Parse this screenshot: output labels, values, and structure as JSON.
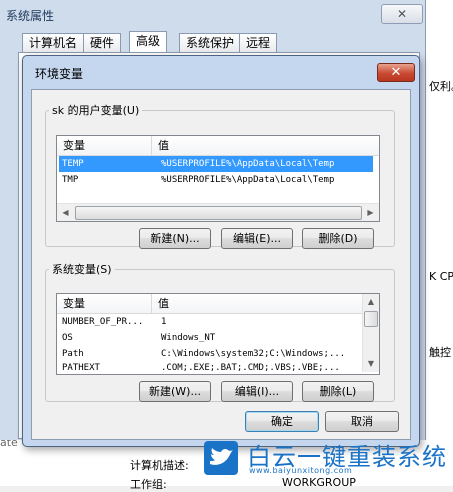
{
  "background": {
    "right_fragments": [
      "仅利。",
      "K CP",
      "触控",
      "ate"
    ],
    "bottom_fragments": [
      "计算机描述:",
      "工作组:",
      "WORKGROUP"
    ]
  },
  "system_properties": {
    "title": "系统属性",
    "close_label": "✕",
    "tabs": [
      {
        "label": "计算机名"
      },
      {
        "label": "硬件"
      },
      {
        "label": "高级"
      },
      {
        "label": "系统保护"
      },
      {
        "label": "远程"
      }
    ],
    "active_tab": "高级"
  },
  "env_dialog": {
    "title": "环境变量",
    "close_label": "✕",
    "user_group": {
      "label": "sk 的用户变量(U)",
      "col_name": "变量",
      "col_value": "值",
      "rows": [
        {
          "name": "TEMP",
          "value": "%USERPROFILE%\\AppData\\Local\\Temp",
          "selected": true
        },
        {
          "name": "TMP",
          "value": "%USERPROFILE%\\AppData\\Local\\Temp",
          "selected": false
        }
      ],
      "buttons": {
        "new": "新建(N)...",
        "edit": "编辑(E)...",
        "delete": "删除(D)"
      }
    },
    "system_group": {
      "label": "系统变量(S)",
      "col_name": "变量",
      "col_value": "值",
      "rows": [
        {
          "name": "NUMBER_OF_PR...",
          "value": "1"
        },
        {
          "name": "OS",
          "value": "Windows_NT"
        },
        {
          "name": "Path",
          "value": "C:\\Windows\\system32;C:\\Windows;..."
        },
        {
          "name": "PATHEXT",
          "value": ".COM;.EXE;.BAT;.CMD;.VBS;.VBE;..."
        }
      ],
      "buttons": {
        "new": "新建(W)...",
        "edit": "编辑(I)...",
        "delete": "删除(L)"
      }
    },
    "ok_label": "确定",
    "cancel_label": "取消"
  },
  "watermark": {
    "title": "白云一键重装系统",
    "url": "www.baiyunxitong.com",
    "color": "#1a73c7"
  }
}
